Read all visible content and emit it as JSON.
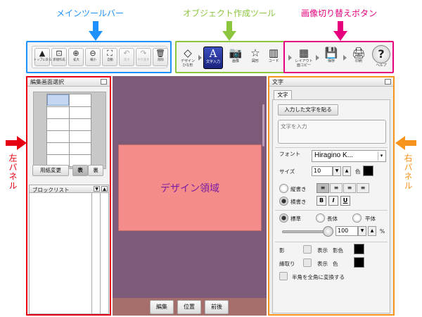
{
  "annotations": {
    "main_toolbar": "メインツールバー",
    "object_toolbar": "オブジェクト作成ツール",
    "image_switch": "画像切り替えボタン",
    "left_panel": "左パネル",
    "right_panel": "右パネル",
    "design_area": "デザイン領域"
  },
  "colors": {
    "main_toolbar": "#1e90ff",
    "object_toolbar": "#8cc63f",
    "image_switch": "#e6007e",
    "left_panel": "#e60012",
    "right_panel": "#f7941d",
    "canvas_bg": "#7d5b78",
    "design_fill": "#f48c89",
    "design_text": "#7b1fa2"
  },
  "main_toolbar": {
    "buttons": [
      {
        "icon": "▲",
        "label": "トップに戻る"
      },
      {
        "icon": "⊡",
        "label": "新規作成"
      },
      {
        "icon": "⊕",
        "label": "拡大"
      },
      {
        "icon": "⊖",
        "label": "縮小"
      },
      {
        "icon": "⛶",
        "label": "自動"
      },
      {
        "icon": "↶",
        "label": "戻す"
      },
      {
        "icon": "↷",
        "label": "やり直す"
      },
      {
        "icon": "🗑",
        "label": "削除"
      }
    ]
  },
  "object_toolbar": {
    "buttons": [
      {
        "icon": "◇",
        "label": "デザイン\nひな形"
      },
      {
        "icon": "A",
        "label": "文字入力"
      },
      {
        "icon": "📷",
        "label": "画像"
      },
      {
        "icon": "☆",
        "label": "図形"
      },
      {
        "icon": "▥",
        "label": "コード"
      }
    ]
  },
  "switch_toolbar": {
    "buttons": [
      {
        "icon": "▦",
        "label": "レイアウト\n面コピー"
      },
      {
        "icon": "💾",
        "label": "保存"
      },
      {
        "icon": "🖨",
        "label": "印刷"
      },
      {
        "icon": "?",
        "label": "ヘルプ"
      }
    ]
  },
  "left_panel": {
    "title": "編集画面選択",
    "paper_change": "用紙変更",
    "front": "表",
    "back": "裏",
    "block_list": "ブロックリスト"
  },
  "canvas": {
    "tabs": [
      "編集",
      "位置",
      "前後"
    ]
  },
  "right_panel": {
    "title": "文字",
    "tab": "文字",
    "paste_button": "入力した文字を貼る",
    "text_placeholder": "文字を入力",
    "font_label": "フォント",
    "font_value": "Hiragino K...",
    "size_label": "サイズ",
    "size_value": "10",
    "color_label": "色",
    "vertical": "縦書き",
    "horizontal": "横書き",
    "bold": "B",
    "italic": "I",
    "underline": "U",
    "standard": "標準",
    "long": "長体",
    "flat": "平体",
    "scale_value": "100",
    "percent": "%",
    "shadow_label": "影",
    "shadow_show": "表示",
    "shadow_color": "影色",
    "outline_label": "縁取り",
    "outline_show": "表示",
    "outline_color": "色",
    "convert_label": "半角を全角に変換する"
  }
}
